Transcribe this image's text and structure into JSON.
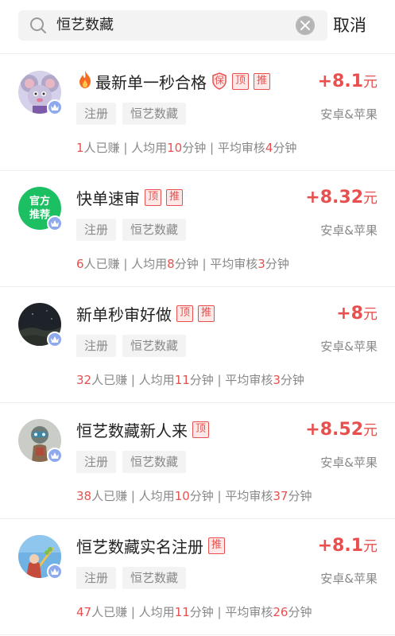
{
  "search": {
    "value": "恒艺数藏",
    "cancel_label": "取消"
  },
  "tasks": [
    {
      "title": "最新单一秒合格",
      "fire": true,
      "tags": [
        "保",
        "顶",
        "推"
      ],
      "reward": "+8.1",
      "unit": "元",
      "chips": [
        "注册",
        "恒艺数藏"
      ],
      "platform": "安卓&苹果",
      "earned": "1",
      "earned_label": "人已赚 | 人均用",
      "avg_minutes": "10",
      "avg_label": "分钟 | 平均审核",
      "review_minutes": "4",
      "review_label": "分钟"
    },
    {
      "title": "快单速审",
      "fire": false,
      "tags": [
        "顶",
        "推"
      ],
      "avatar_text": [
        "官方",
        "推荐"
      ],
      "reward": "+8.32",
      "unit": "元",
      "chips": [
        "注册",
        "恒艺数藏"
      ],
      "platform": "安卓&苹果",
      "earned": "6",
      "earned_label": "人已赚 | 人均用",
      "avg_minutes": "8",
      "avg_label": "分钟 | 平均审核",
      "review_minutes": "3",
      "review_label": "分钟"
    },
    {
      "title": "新单秒审好做",
      "fire": false,
      "tags": [
        "顶",
        "推"
      ],
      "reward": "+8",
      "unit": "元",
      "chips": [
        "注册",
        "恒艺数藏"
      ],
      "platform": "安卓&苹果",
      "earned": "32",
      "earned_label": "人已赚 | 人均用",
      "avg_minutes": "11",
      "avg_label": "分钟 | 平均审核",
      "review_minutes": "3",
      "review_label": "分钟"
    },
    {
      "title": "恒艺数藏新人来",
      "fire": false,
      "tags": [
        "顶"
      ],
      "reward": "+8.52",
      "unit": "元",
      "chips": [
        "注册",
        "恒艺数藏"
      ],
      "platform": "安卓&苹果",
      "earned": "38",
      "earned_label": "人已赚 | 人均用",
      "avg_minutes": "10",
      "avg_label": "分钟 | 平均审核",
      "review_minutes": "37",
      "review_label": "分钟"
    },
    {
      "title": "恒艺数藏实名注册",
      "fire": false,
      "tags": [
        "推"
      ],
      "reward": "+8.1",
      "unit": "元",
      "chips": [
        "注册",
        "恒艺数藏"
      ],
      "platform": "安卓&苹果",
      "earned": "47",
      "earned_label": "人已赚 | 人均用",
      "avg_minutes": "11",
      "avg_label": "分钟 | 平均审核",
      "review_minutes": "26",
      "review_label": "分钟"
    }
  ],
  "colors": {
    "accent": "#e8504f",
    "muted": "#888888",
    "chip_bg": "#f3f3f3"
  }
}
